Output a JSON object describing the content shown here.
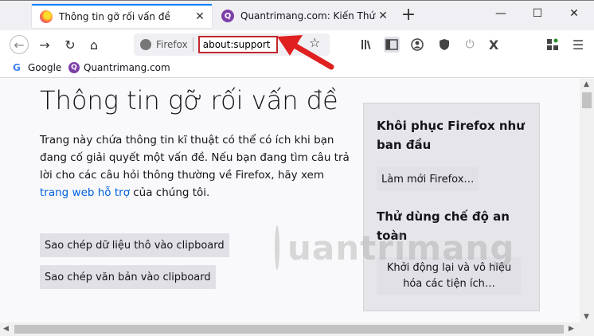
{
  "tabs": [
    {
      "title": "Thông tin gỡ rối vấn đề",
      "close": "✕",
      "favicon": "firefox-icon"
    },
    {
      "title": "Quantrimang.com: Kiến Thức C",
      "close": "✕",
      "favicon": "quantrimang-icon"
    }
  ],
  "window": {
    "new_tab": "+",
    "minimize": "—",
    "maximize": "☐",
    "close": "✕"
  },
  "nav": {
    "back": "←",
    "forward": "→",
    "reload": "↻",
    "home": "⌂",
    "identity_label": "Firefox",
    "url": "about:support",
    "star": "☆"
  },
  "toolbar_icons": [
    "library-icon",
    "sidebar-icon",
    "account-icon",
    "shield-icon",
    "power-icon",
    "x-icon",
    "extensions-icon",
    "menu-icon"
  ],
  "bookmarks": [
    {
      "label": "Google",
      "icon": "G"
    },
    {
      "label": "Quantrimang.com",
      "icon": "Q"
    }
  ],
  "page": {
    "title": "Thông tin gỡ rối vấn đề",
    "intro_text": "Trang này chứa thông tin kĩ thuật có thể có ích khi bạn đang cố giải quyết một vấn đề. Nếu bạn đang tìm câu trả lời cho các câu hỏi thông thường về Firefox, hãy xem ",
    "intro_link": "trang web hỗ trợ",
    "intro_tail": " của chúng tôi.",
    "copy_raw_button": "Sao chép dữ liệu thô vào clipboard",
    "copy_text_button": "Sao chép văn bản vào clipboard"
  },
  "sidebar": {
    "reset_heading": "Khôi phục Firefox như ban đầu",
    "refresh_button": "Làm mới Firefox…",
    "safe_mode_heading": "Thử dùng chế độ an toàn",
    "restart_button": "Khởi động lại và vô hiệu hóa các tiện ích…"
  },
  "watermark": {
    "text": "uantrimang"
  },
  "colors": {
    "accent": "#0a84ff",
    "highlight": "#c1272d",
    "link": "#0061e0",
    "arrow": "#e02020"
  }
}
